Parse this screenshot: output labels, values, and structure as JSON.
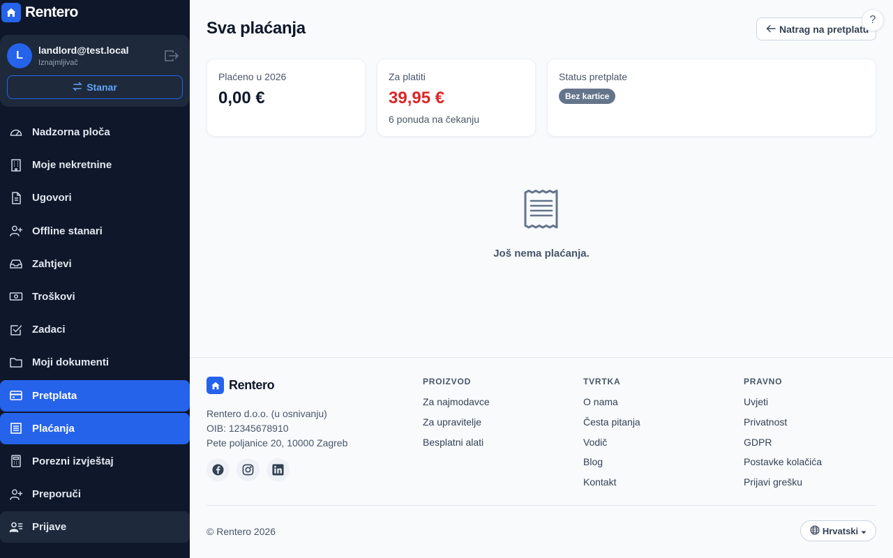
{
  "brand": {
    "name": "Rentero"
  },
  "user": {
    "initial": "L",
    "email": "landlord@test.local",
    "role": "Iznajmljivač",
    "switch_label": "Stanar"
  },
  "nav": [
    {
      "label": "Nadzorna ploča",
      "icon": "dashboard-icon"
    },
    {
      "label": "Moje nekretnine",
      "icon": "building-icon"
    },
    {
      "label": "Ugovori",
      "icon": "document-icon"
    },
    {
      "label": "Offline stanari",
      "icon": "user-plus-icon"
    },
    {
      "label": "Zahtjevi",
      "icon": "inbox-icon"
    },
    {
      "label": "Troškovi",
      "icon": "cash-icon"
    },
    {
      "label": "Zadaci",
      "icon": "checkbox-icon"
    },
    {
      "label": "Moji dokumenti",
      "icon": "folder-icon"
    },
    {
      "label": "Pretplata",
      "icon": "credit-card-icon",
      "state": "active"
    },
    {
      "label": "Plaćanja",
      "icon": "receipt-icon",
      "state": "active"
    },
    {
      "label": "Porezni izvještaj",
      "icon": "calculator-icon"
    },
    {
      "label": "Preporuči",
      "icon": "user-plus-icon"
    },
    {
      "label": "Prijave",
      "icon": "user-list-icon",
      "state": "hover"
    }
  ],
  "header": {
    "title": "Sva plaćanja",
    "back_label": "Natrag na pretplatu",
    "help_label": "?"
  },
  "cards": {
    "paid": {
      "label": "Plaćeno u 2026",
      "value": "0,00 €"
    },
    "due": {
      "label": "Za platiti",
      "value": "39,95 €",
      "sub": "6 ponuda na čekanju",
      "color": "#dc2626"
    },
    "status": {
      "label": "Status pretplate",
      "badge": "Bez kartice"
    }
  },
  "empty": {
    "text": "Još nema plaćanja.",
    "icon": "receipt-icon"
  },
  "footer": {
    "brand": "Rentero",
    "company": [
      "Rentero d.o.o. (u osnivanju)",
      "OIB: 12345678910",
      "Pete poljanice 20, 10000 Zagreb"
    ],
    "columns": [
      {
        "title": "PROIZVOD",
        "links": [
          "Za najmodavce",
          "Za upravitelje",
          "Besplatni alati"
        ]
      },
      {
        "title": "TVRTKA",
        "links": [
          "O nama",
          "Česta pitanja",
          "Vodič",
          "Blog",
          "Kontakt"
        ]
      },
      {
        "title": "PRAVNO",
        "links": [
          "Uvjeti",
          "Privatnost",
          "GDPR",
          "Postavke kolačića",
          "Prijavi grešku"
        ]
      }
    ],
    "copyright": "© Rentero 2026",
    "language": "Hrvatski"
  },
  "colors": {
    "primary": "#2563eb",
    "sidebar": "#0f172a",
    "danger": "#dc2626"
  }
}
